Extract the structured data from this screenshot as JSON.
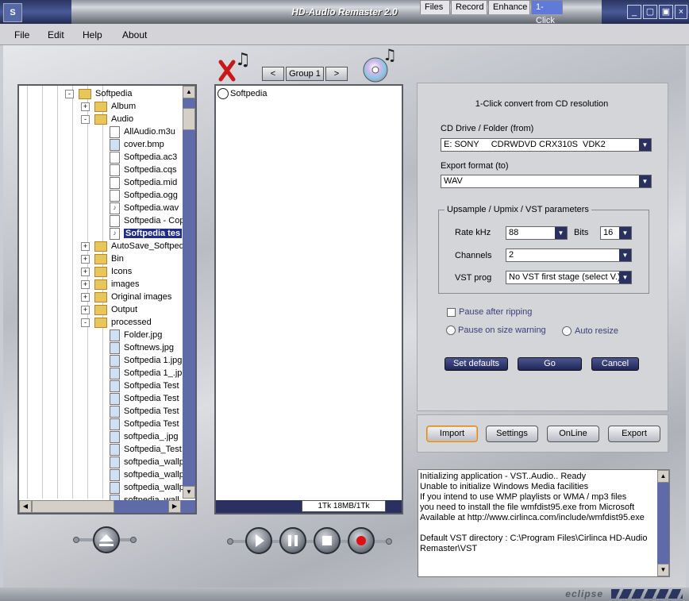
{
  "window": {
    "title": "HD-Audio Remaster 2.0"
  },
  "menu": [
    "File",
    "Edit",
    "Help",
    "About"
  ],
  "group": {
    "prev": "<",
    "label": "Group 1",
    "next": ">"
  },
  "tree": {
    "items": [
      {
        "label": "Softpedia",
        "kind": "folder",
        "expander": "-",
        "indent": 0
      },
      {
        "label": "Album",
        "kind": "folder",
        "expander": "+",
        "indent": 1
      },
      {
        "label": "Audio",
        "kind": "folder",
        "expander": "-",
        "indent": 1
      },
      {
        "label": "AllAudio.m3u",
        "kind": "file",
        "indent": 2
      },
      {
        "label": "cover.bmp",
        "kind": "image",
        "indent": 2
      },
      {
        "label": "Softpedia.ac3",
        "kind": "file",
        "indent": 2
      },
      {
        "label": "Softpedia.cqs",
        "kind": "file",
        "indent": 2
      },
      {
        "label": "Softpedia.mid",
        "kind": "file",
        "indent": 2
      },
      {
        "label": "Softpedia.ogg",
        "kind": "file",
        "indent": 2
      },
      {
        "label": "Softpedia.wav",
        "kind": "audio",
        "indent": 2
      },
      {
        "label": "Softpedia - Cop",
        "kind": "file",
        "indent": 2
      },
      {
        "label": "Softpedia tes",
        "kind": "audio",
        "indent": 2,
        "selected": true
      },
      {
        "label": "AutoSave_Softped",
        "kind": "folder",
        "expander": "+",
        "indent": 1
      },
      {
        "label": "Bin",
        "kind": "folder",
        "expander": "+",
        "indent": 1
      },
      {
        "label": "Icons",
        "kind": "folder",
        "expander": "+",
        "indent": 1
      },
      {
        "label": "images",
        "kind": "folder",
        "expander": "+",
        "indent": 1
      },
      {
        "label": "Original images",
        "kind": "folder",
        "expander": "+",
        "indent": 1
      },
      {
        "label": "Output",
        "kind": "folder",
        "expander": "+",
        "indent": 1
      },
      {
        "label": "processed",
        "kind": "folder",
        "expander": "-",
        "indent": 1
      },
      {
        "label": "Folder.jpg",
        "kind": "image",
        "indent": 2
      },
      {
        "label": "Softnews.jpg",
        "kind": "image",
        "indent": 2
      },
      {
        "label": "Softpedia 1.jpg",
        "kind": "image",
        "indent": 2
      },
      {
        "label": "Softpedia 1_.jp",
        "kind": "image",
        "indent": 2
      },
      {
        "label": "Softpedia Test",
        "kind": "image",
        "indent": 2
      },
      {
        "label": "Softpedia Test",
        "kind": "image",
        "indent": 2
      },
      {
        "label": "Softpedia Test",
        "kind": "image",
        "indent": 2
      },
      {
        "label": "Softpedia Test",
        "kind": "image",
        "indent": 2
      },
      {
        "label": "softpedia_.jpg",
        "kind": "image",
        "indent": 2
      },
      {
        "label": "Softpedia_Test",
        "kind": "image",
        "indent": 2
      },
      {
        "label": "softpedia_wallp",
        "kind": "image",
        "indent": 2
      },
      {
        "label": "softpedia_wallp",
        "kind": "image",
        "indent": 2
      },
      {
        "label": "softpedia_wallp",
        "kind": "image",
        "indent": 2
      },
      {
        "label": "softpedia_wall",
        "kind": "image",
        "indent": 2
      }
    ]
  },
  "tracks": {
    "items": [
      "Softpedia"
    ],
    "status": "1Tk 18MB/1Tk"
  },
  "tabs": [
    {
      "label": "Files",
      "active": false
    },
    {
      "label": "Record",
      "active": false
    },
    {
      "label": "Enhance",
      "active": false
    },
    {
      "label": "1-Click",
      "active": true
    }
  ],
  "oneclick": {
    "heading": "1-Click convert from CD resolution",
    "cd_label": "CD Drive / Folder (from)",
    "cd_value": "E: SONY     CDRWDVD CRX310S  VDK2",
    "export_label": "Export format (to)",
    "export_value": "WAV",
    "params_legend": "Upsample / Upmix / VST parameters",
    "rate_label": "Rate kHz",
    "rate_value": "88",
    "bits_label": "Bits",
    "bits_value": "16",
    "channels_label": "Channels",
    "channels_value": "2",
    "vst_label": "VST prog",
    "vst_value": "No VST first stage (select V.)",
    "pause_ripping": "Pause after ripping",
    "pause_size": "Pause on size warning",
    "auto_resize": "Auto resize",
    "set_defaults": "Set defaults",
    "go": "Go",
    "cancel": "Cancel"
  },
  "actions": {
    "import": "Import",
    "settings": "Settings",
    "online": "OnLine",
    "export": "Export"
  },
  "log": [
    "Initializing application - VST..Audio.. Ready",
    "Unable to initialize Windows Media facilities",
    "If you intend to use WMP playlists or WMA / mp3 files",
    "you need to install the file wmfdist95.exe from Microsoft",
    "Available at http://www.cirlinca.com/include/wmfdist95.exe",
    "",
    "Default VST directory : C:\\Program Files\\Cirlinca HD-Audio",
    "Remaster\\VST"
  ],
  "brand": "eclipse"
}
